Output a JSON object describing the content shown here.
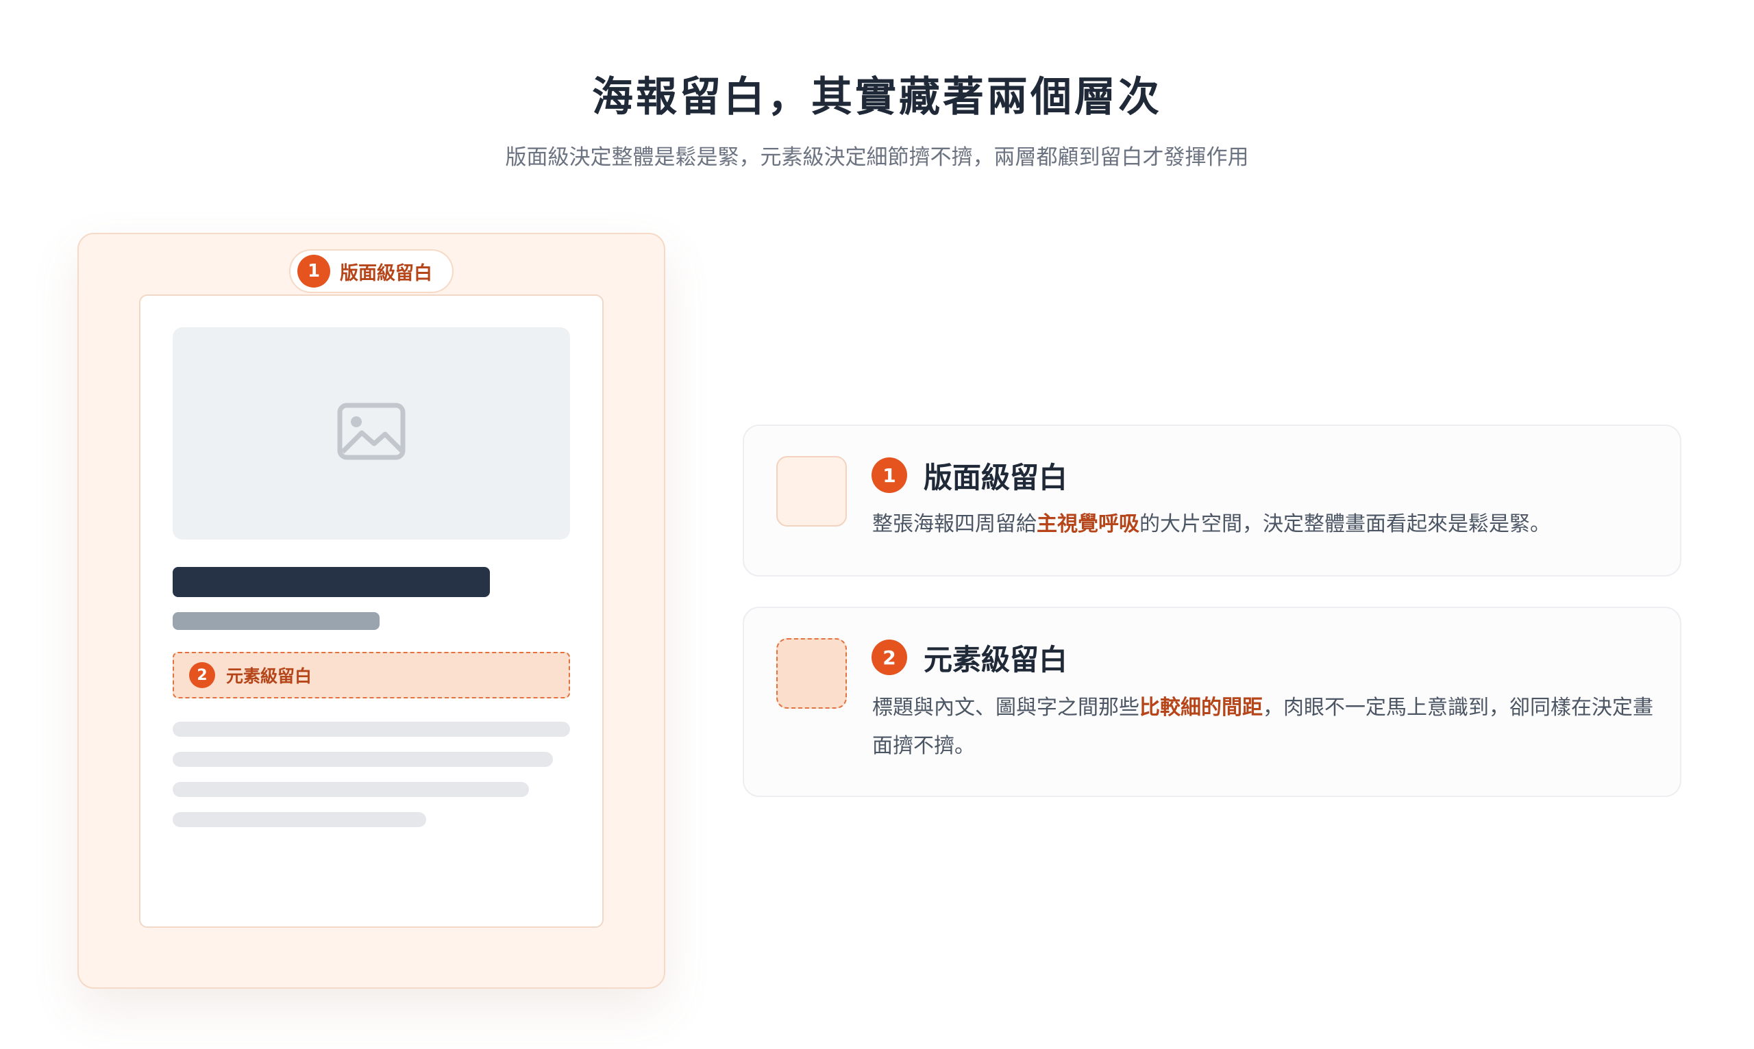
{
  "header": {
    "title": "海報留白，其實藏著兩個層次",
    "subtitle": "版面級決定整體是鬆是緊，元素級決定細節擠不擠，兩層都顧到留白才發揮作用"
  },
  "poster": {
    "page_tag": {
      "number": "1",
      "label": "版面級留白"
    },
    "image_placeholder_icon": "image-icon",
    "element_tag": {
      "number": "2",
      "label": "元素級留白"
    }
  },
  "cards": [
    {
      "number": "1",
      "title": "版面級留白",
      "desc_before": "整張海報四周留給",
      "desc_highlight": "主視覺呼吸",
      "desc_after": "的大片空間，決定整體畫面看起來是鬆是緊。"
    },
    {
      "number": "2",
      "title": "元素級留白",
      "desc_before": "標題與內文、圖與字之間那些",
      "desc_highlight": "比較細的間距",
      "desc_after": "，肉眼不一定馬上意識到，卻同樣在決定畫面擠不擠。"
    }
  ],
  "colors": {
    "accent": "#e5531f",
    "highlight_text": "#b6461a",
    "poster_bg": "#fff3eb",
    "element_bg": "#fbe0cf"
  }
}
